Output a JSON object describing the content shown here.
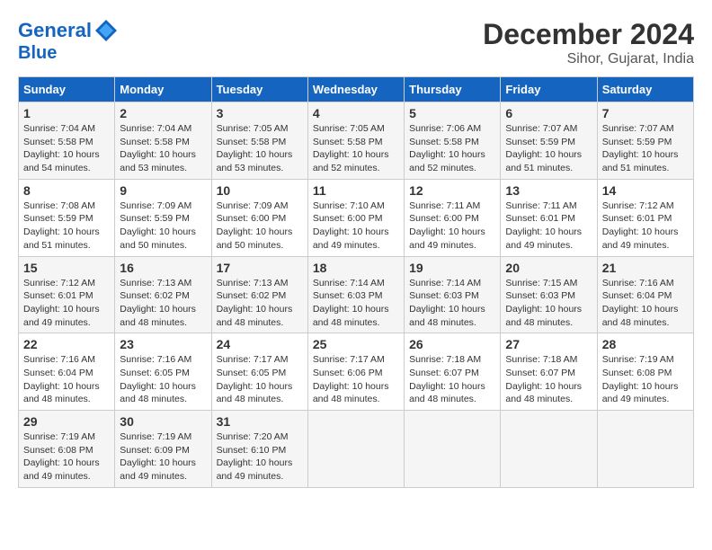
{
  "header": {
    "logo_line1": "General",
    "logo_line2": "Blue",
    "month": "December 2024",
    "location": "Sihor, Gujarat, India"
  },
  "weekdays": [
    "Sunday",
    "Monday",
    "Tuesday",
    "Wednesday",
    "Thursday",
    "Friday",
    "Saturday"
  ],
  "weeks": [
    [
      {
        "day": "1",
        "sunrise": "7:04 AM",
        "sunset": "5:58 PM",
        "daylight": "10 hours and 54 minutes."
      },
      {
        "day": "2",
        "sunrise": "7:04 AM",
        "sunset": "5:58 PM",
        "daylight": "10 hours and 53 minutes."
      },
      {
        "day": "3",
        "sunrise": "7:05 AM",
        "sunset": "5:58 PM",
        "daylight": "10 hours and 53 minutes."
      },
      {
        "day": "4",
        "sunrise": "7:05 AM",
        "sunset": "5:58 PM",
        "daylight": "10 hours and 52 minutes."
      },
      {
        "day": "5",
        "sunrise": "7:06 AM",
        "sunset": "5:58 PM",
        "daylight": "10 hours and 52 minutes."
      },
      {
        "day": "6",
        "sunrise": "7:07 AM",
        "sunset": "5:59 PM",
        "daylight": "10 hours and 51 minutes."
      },
      {
        "day": "7",
        "sunrise": "7:07 AM",
        "sunset": "5:59 PM",
        "daylight": "10 hours and 51 minutes."
      }
    ],
    [
      {
        "day": "8",
        "sunrise": "7:08 AM",
        "sunset": "5:59 PM",
        "daylight": "10 hours and 51 minutes."
      },
      {
        "day": "9",
        "sunrise": "7:09 AM",
        "sunset": "5:59 PM",
        "daylight": "10 hours and 50 minutes."
      },
      {
        "day": "10",
        "sunrise": "7:09 AM",
        "sunset": "6:00 PM",
        "daylight": "10 hours and 50 minutes."
      },
      {
        "day": "11",
        "sunrise": "7:10 AM",
        "sunset": "6:00 PM",
        "daylight": "10 hours and 49 minutes."
      },
      {
        "day": "12",
        "sunrise": "7:11 AM",
        "sunset": "6:00 PM",
        "daylight": "10 hours and 49 minutes."
      },
      {
        "day": "13",
        "sunrise": "7:11 AM",
        "sunset": "6:01 PM",
        "daylight": "10 hours and 49 minutes."
      },
      {
        "day": "14",
        "sunrise": "7:12 AM",
        "sunset": "6:01 PM",
        "daylight": "10 hours and 49 minutes."
      }
    ],
    [
      {
        "day": "15",
        "sunrise": "7:12 AM",
        "sunset": "6:01 PM",
        "daylight": "10 hours and 49 minutes."
      },
      {
        "day": "16",
        "sunrise": "7:13 AM",
        "sunset": "6:02 PM",
        "daylight": "10 hours and 48 minutes."
      },
      {
        "day": "17",
        "sunrise": "7:13 AM",
        "sunset": "6:02 PM",
        "daylight": "10 hours and 48 minutes."
      },
      {
        "day": "18",
        "sunrise": "7:14 AM",
        "sunset": "6:03 PM",
        "daylight": "10 hours and 48 minutes."
      },
      {
        "day": "19",
        "sunrise": "7:14 AM",
        "sunset": "6:03 PM",
        "daylight": "10 hours and 48 minutes."
      },
      {
        "day": "20",
        "sunrise": "7:15 AM",
        "sunset": "6:03 PM",
        "daylight": "10 hours and 48 minutes."
      },
      {
        "day": "21",
        "sunrise": "7:16 AM",
        "sunset": "6:04 PM",
        "daylight": "10 hours and 48 minutes."
      }
    ],
    [
      {
        "day": "22",
        "sunrise": "7:16 AM",
        "sunset": "6:04 PM",
        "daylight": "10 hours and 48 minutes."
      },
      {
        "day": "23",
        "sunrise": "7:16 AM",
        "sunset": "6:05 PM",
        "daylight": "10 hours and 48 minutes."
      },
      {
        "day": "24",
        "sunrise": "7:17 AM",
        "sunset": "6:05 PM",
        "daylight": "10 hours and 48 minutes."
      },
      {
        "day": "25",
        "sunrise": "7:17 AM",
        "sunset": "6:06 PM",
        "daylight": "10 hours and 48 minutes."
      },
      {
        "day": "26",
        "sunrise": "7:18 AM",
        "sunset": "6:07 PM",
        "daylight": "10 hours and 48 minutes."
      },
      {
        "day": "27",
        "sunrise": "7:18 AM",
        "sunset": "6:07 PM",
        "daylight": "10 hours and 48 minutes."
      },
      {
        "day": "28",
        "sunrise": "7:19 AM",
        "sunset": "6:08 PM",
        "daylight": "10 hours and 49 minutes."
      }
    ],
    [
      {
        "day": "29",
        "sunrise": "7:19 AM",
        "sunset": "6:08 PM",
        "daylight": "10 hours and 49 minutes."
      },
      {
        "day": "30",
        "sunrise": "7:19 AM",
        "sunset": "6:09 PM",
        "daylight": "10 hours and 49 minutes."
      },
      {
        "day": "31",
        "sunrise": "7:20 AM",
        "sunset": "6:10 PM",
        "daylight": "10 hours and 49 minutes."
      },
      null,
      null,
      null,
      null
    ]
  ],
  "labels": {
    "sunrise": "Sunrise:",
    "sunset": "Sunset:",
    "daylight": "Daylight:"
  }
}
